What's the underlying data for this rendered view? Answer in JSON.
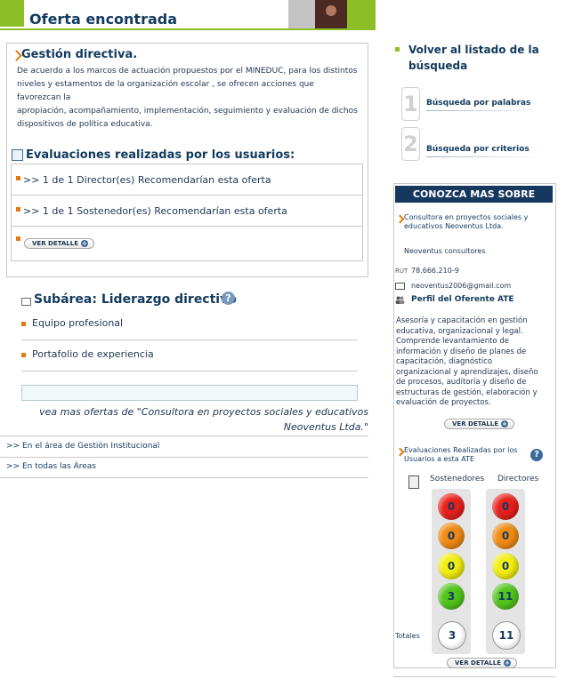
{
  "header": {
    "title": "Oferta encontrada",
    "accent_color": "#8cbf26"
  },
  "gestion": {
    "title": "Gestión directiva.",
    "description_lines": [
      "De acuerdo a los marcos de actuación propuestos por el MINEDUC, para los distintos",
      "niveles y estamentos de la organización escolar , se ofrecen acciones que favorezcan la",
      "apropiación, acompañamiento, implementación, seguimiento y evaluación de dichos",
      "dispositivos de política educativa."
    ]
  },
  "evaluaciones": {
    "title": "Evaluaciones realizadas por los usuarios:",
    "rows": [
      ">> 1 de 1 Director(es) Recomendarían esta oferta",
      ">> 1 de 1 Sostenedor(es) Recomendarían esta oferta"
    ],
    "detail_button": "VER DETALLE"
  },
  "subarea": {
    "title": "Subárea: Liderazgo directivo",
    "help_icon": "?",
    "items": [
      "Equipo profesional",
      "Portafolio de experiencia"
    ],
    "more_offers_line1": "vea mas ofertas de \"Consultora en proyectos sociales y educativos",
    "more_offers_line2": "Neoventus Ltda.\""
  },
  "area_links": [
    ">> En el área de Gestión Institucional",
    ">> En todas las Áreas"
  ],
  "sidebar": {
    "back_link_line1": "Volver al listado de la",
    "back_link_line2": "búsqueda",
    "steps": [
      {
        "number": "1",
        "label": "Búsqueda por palabras"
      },
      {
        "number": "2",
        "label": "Búsqueda por criterios"
      }
    ]
  },
  "conozca": {
    "title": "CONOZCA MAS SOBRE",
    "consultora_line1": "Consultora en proyectos sociales y",
    "consultora_line2": "educativos Neoventus Ltda.",
    "name": "Neoventus consultores",
    "rut_label": "RUT",
    "rut": "78.666.210-9",
    "email": "neoventus2006@gmail.com",
    "perfil_title": "Perfil del Oferente ATE",
    "perfil_lines": [
      "Asesoría y capacitación en gestión",
      "educativa, organizacional y legal.",
      "Comprende levantamiento de",
      "información y diseño de planes de",
      "capacitación, diagnóstico",
      "organizacional y aprendizajes, diseño",
      "de procesos, auditoría y diseño de",
      "estructuras de gestión, elaboración y",
      "evaluación de proyectos."
    ],
    "detail_button": "VER DETALLE",
    "eval_title_line1": "Evaluaciones Realizadas por los",
    "eval_title_line2": "Usuarios a esta ATE",
    "col_sostenedores": "Sostenedores",
    "col_directores": "Directores",
    "sostenedores": {
      "red": "0",
      "orange": "0",
      "yellow": "0",
      "green": "3",
      "total": "3"
    },
    "directores": {
      "red": "0",
      "orange": "0",
      "yellow": "0",
      "green": "11",
      "total": "11"
    },
    "totales_label": "Totales",
    "detail_button_2": "VER DETALLE",
    "colors": {
      "red": "#e8201c",
      "orange": "#f08a12",
      "yellow": "#f2ee10",
      "green": "#52c41c",
      "navy": "#16375e"
    }
  }
}
